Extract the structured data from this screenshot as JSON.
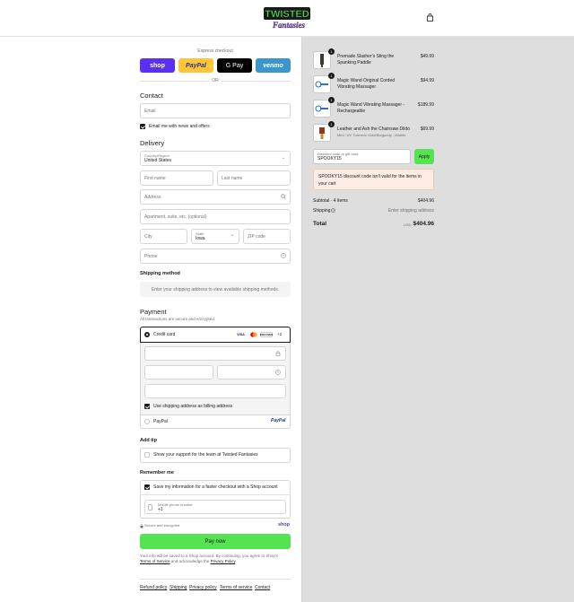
{
  "header": {
    "logo_text_top": "TWISTED",
    "logo_text_bottom": "Fantasies",
    "cart_icon": "shopping-bag-icon"
  },
  "express": {
    "title": "Express checkout",
    "buttons": [
      {
        "label": "shop",
        "color": "#5a31f4"
      },
      {
        "label": "PayPal",
        "color": "#ffc439"
      },
      {
        "label": "G Pay",
        "color": "#000000"
      },
      {
        "label": "venmo",
        "color": "#3d95ce"
      }
    ],
    "or": "OR"
  },
  "contact": {
    "title": "Contact",
    "email_placeholder": "Email",
    "news_label": "Email me with news and offers"
  },
  "delivery": {
    "title": "Delivery",
    "country_label": "Country/Region",
    "country_value": "United States",
    "first_name": "First name",
    "last_name": "Last name",
    "address": "Address",
    "apartment": "Apartment, suite, etc. (optional)",
    "city": "City",
    "state_label": "State",
    "state_value": "Iowa",
    "zip": "ZIP code",
    "phone": "Phone"
  },
  "shipping": {
    "title": "Shipping method",
    "message": "Enter your shipping address to view available shipping methods."
  },
  "payment": {
    "title": "Payment",
    "subtitle": "All transactions are secure and encrypted.",
    "credit_card": "Credit card",
    "cards": [
      "VISA",
      "MC",
      "DISCOVER"
    ],
    "more_cards": "+2",
    "billing_label": "Use shipping address as billing address",
    "paypal": "PayPal"
  },
  "tip": {
    "title": "Add tip",
    "label": "Show your support for the team at Twisted Fantasies"
  },
  "remember": {
    "title": "Remember me",
    "save_label": "Save my information for a faster checkout with a Shop account",
    "mobile_label": "Mobile phone number",
    "mobile_value": "+1",
    "secure": "Secure and encrypted",
    "shop": "shop"
  },
  "pay_now": "Pay now",
  "disclaimer": {
    "line1": "Your info will be saved to a Shop account. By continuing, you agree to Shop's",
    "terms": "Terms of Service",
    "mid": "and acknowledge the",
    "privacy": "Privacy Policy",
    "end": "."
  },
  "footer_links": [
    "Refund policy",
    "Shipping",
    "Privacy policy",
    "Terms of service",
    "Contact"
  ],
  "order": {
    "items": [
      {
        "qty": "1",
        "name": "Premade Slasher's Sting the Spanking Paddle",
        "sub": "",
        "price": "$49.99"
      },
      {
        "qty": "1",
        "name": "Magic Wand Original Corded Vibrating Massager",
        "sub": "",
        "price": "$94.99"
      },
      {
        "qty": "1",
        "name": "Magic Wand Vibrating Massager - Rechargeable",
        "sub": "",
        "price": "$189.99"
      },
      {
        "qty": "1",
        "name": "Leather and Ash the Chainsaw Dildo",
        "sub": "Mini / UV Turmeric Gold/Burgundy - Marble",
        "price": "$69.99"
      }
    ],
    "discount_label": "Discount code or gift card",
    "discount_value": "SPOOKY15",
    "apply": "Apply",
    "warning": "SPOOKY15 discount code isn't valid for the items in your cart",
    "subtotal_label": "Subtotal · 4 items",
    "subtotal_value": "$404.96",
    "shipping_label": "Shipping",
    "shipping_value": "Enter shipping address",
    "total_label": "Total",
    "currency": "USD",
    "total_value": "$404.96"
  }
}
